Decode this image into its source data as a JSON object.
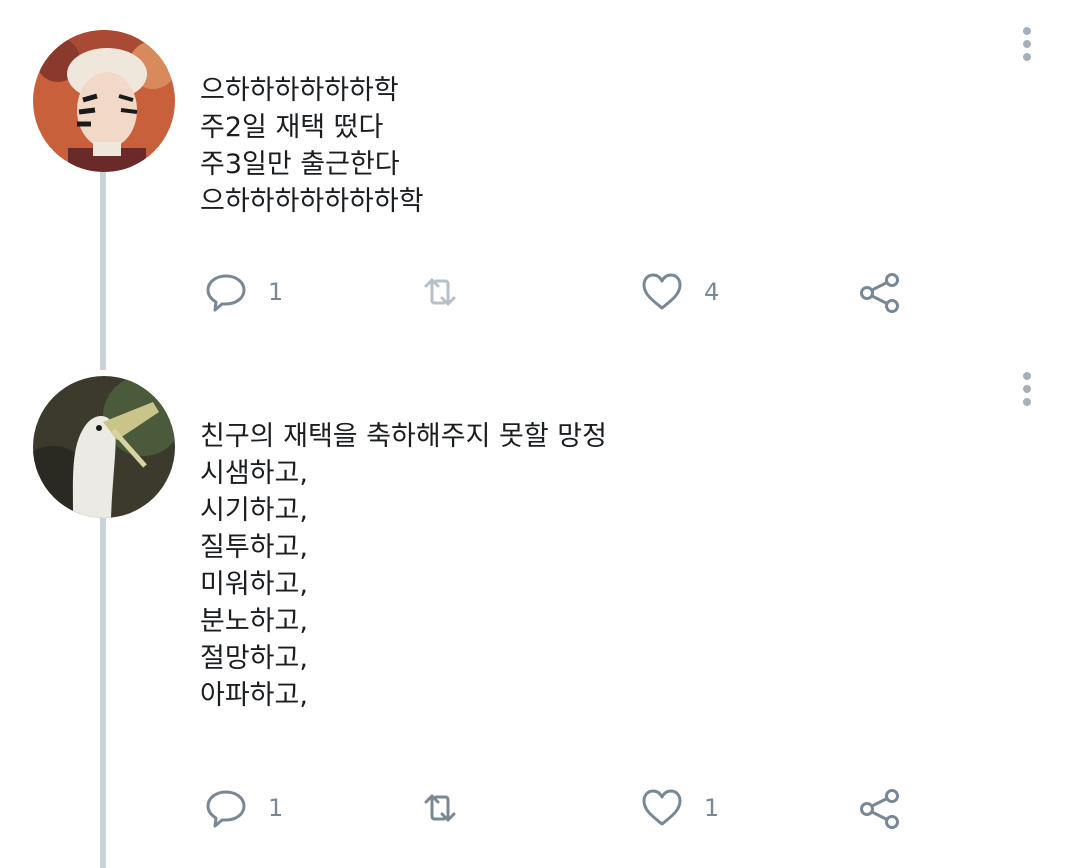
{
  "tweets": [
    {
      "lines": [
        "으하하하하하하학",
        "주2일 재택 떴다",
        "주3일만 출근한다",
        "으하하하하하하하학"
      ],
      "reply_count": "1",
      "retweet_count": "",
      "like_count": "4"
    },
    {
      "lines": [
        "친구의 재택을 축하해주지 못할 망정",
        "시샘하고,",
        "시기하고,",
        "질투하고,",
        "미워하고,",
        "분노하고,",
        "절망하고,",
        "아파하고,"
      ],
      "reply_count": "1",
      "retweet_count": "",
      "like_count": "1"
    }
  ],
  "colors": {
    "icon": "#7a8896",
    "thread_line": "#c9d3dc",
    "text": "#1b1e21"
  },
  "icons": [
    "reply-icon",
    "retweet-icon",
    "like-icon",
    "share-icon",
    "more-options-icon"
  ]
}
